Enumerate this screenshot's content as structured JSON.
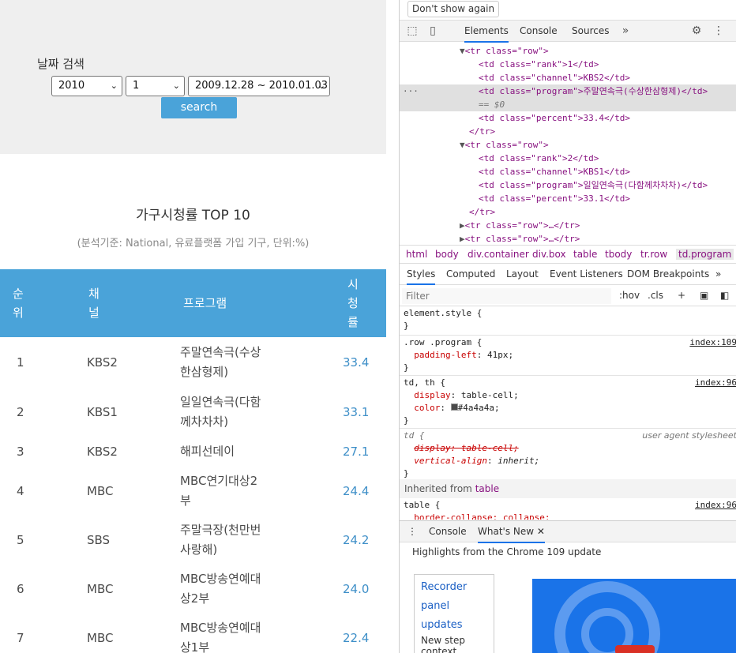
{
  "search": {
    "title": "날짜 검색",
    "year": "2010",
    "week": "1",
    "range": "2009.12.28 ~ 2010.01.03",
    "button": "search"
  },
  "rating": {
    "title": "가구시청률 TOP 10",
    "subtitle": "(분석기준: National, 유료플랫폼 가입 기구, 단위:%)",
    "headers": [
      "순\n위",
      "채\n널",
      "프로그램",
      "시\n청\n률"
    ],
    "rows": [
      {
        "rank": "1",
        "channel": "KBS2",
        "program": "주말연속극(수상한삼형제)",
        "percent": "33.4"
      },
      {
        "rank": "2",
        "channel": "KBS1",
        "program": "일일연속극(다함께차차차)",
        "percent": "33.1"
      },
      {
        "rank": "3",
        "channel": "KBS2",
        "program": "해피선데이",
        "percent": "27.1"
      },
      {
        "rank": "4",
        "channel": "MBC",
        "program": "MBC연기대상2부",
        "percent": "24.4"
      },
      {
        "rank": "5",
        "channel": "SBS",
        "program": "주말극장(천만번사랑해)",
        "percent": "24.2"
      },
      {
        "rank": "6",
        "channel": "MBC",
        "program": "MBC방송연예대상2부",
        "percent": "24.0"
      },
      {
        "rank": "7",
        "channel": "MBC",
        "program": "MBC방송연예대상1부",
        "percent": "22.4"
      }
    ]
  },
  "devtools": {
    "dont_show": "Don't show again",
    "tabs": [
      "Elements",
      "Console",
      "Sources"
    ],
    "dom_lines": [
      {
        "indent": 0,
        "arrow": "▼",
        "html": "<tr class=\"row\">"
      },
      {
        "indent": 1,
        "arrow": "",
        "html": "<td class=\"rank\">1</td>"
      },
      {
        "indent": 1,
        "arrow": "",
        "html": "<td class=\"channel\">KBS2</td>"
      },
      {
        "indent": 1,
        "arrow": "",
        "html": "<td class=\"program\">주말연속극(수상한삼형제)</td>"
      },
      {
        "indent": 1,
        "arrow": "",
        "html": "== $0"
      },
      {
        "indent": 1,
        "arrow": "",
        "html": "<td class=\"percent\">33.4</td>"
      },
      {
        "indent": 0,
        "arrow": "",
        "html": "</tr>"
      },
      {
        "indent": 0,
        "arrow": "▼",
        "html": "<tr class=\"row\">"
      },
      {
        "indent": 1,
        "arrow": "",
        "html": "<td class=\"rank\">2</td>"
      },
      {
        "indent": 1,
        "arrow": "",
        "html": "<td class=\"channel\">KBS1</td>"
      },
      {
        "indent": 1,
        "arrow": "",
        "html": "<td class=\"program\">일일연속극(다함께차차차)</td>"
      },
      {
        "indent": 1,
        "arrow": "",
        "html": "<td class=\"percent\">33.1</td>"
      },
      {
        "indent": 0,
        "arrow": "",
        "html": "</tr>"
      },
      {
        "indent": 0,
        "arrow": "▶",
        "html": "<tr class=\"row\">…</tr>"
      },
      {
        "indent": 0,
        "arrow": "▶",
        "html": "<tr class=\"row\">…</tr>"
      }
    ],
    "breadcrumbs": [
      "html",
      "body",
      "div.container",
      "div.box",
      "table",
      "tbody",
      "tr.row",
      "td.program"
    ],
    "styles_tabs": [
      "Styles",
      "Computed",
      "Layout",
      "Event Listeners",
      "DOM Breakpoints"
    ],
    "filter_placeholder": "Filter",
    "hov": ":hov",
    "cls": ".cls",
    "rules": {
      "element_style": "element.style {",
      "close": "}",
      "row_program_sel": ".row .program {",
      "row_program_src": "index:109",
      "row_program_prop": "padding-left",
      "row_program_val": "41px;",
      "tdth_sel": "td, th {",
      "tdth_src": "index:96",
      "tdth_display": "display",
      "tdth_display_val": "table-cell;",
      "tdth_color": "color",
      "tdth_color_val": "#4a4a4a;",
      "td_sel": "td {",
      "td_src": "user agent stylesheet",
      "td_display": "display: table-cell;",
      "td_valign": "vertical-align",
      "td_valign_val": "inherit;",
      "inherited_label": "Inherited from",
      "inherited_from": "table",
      "table_sel": "table {",
      "table_src": "index:96",
      "table_prop": "border-collapse: collapse;"
    },
    "drawer_tabs": [
      "Console",
      "What's New"
    ],
    "highlights": "Highlights from the Chrome 109 update",
    "recorder_links": [
      "Recorder",
      "panel",
      "updates"
    ],
    "recorder_desc": "New step context menu,"
  }
}
